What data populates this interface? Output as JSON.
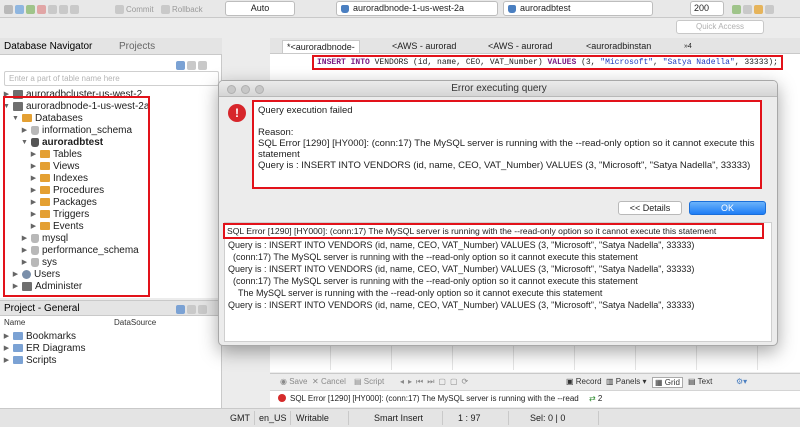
{
  "toolbar": {
    "commit_label": "Commit",
    "rollback_label": "Rollback",
    "transaction_mode": "Auto",
    "datasource": "auroradbnode-1-us-west-2a",
    "database": "auroradbtest",
    "result_limit": "200",
    "quick_access_placeholder": "Quick Access"
  },
  "nav": {
    "tab_active": "Database Navigator",
    "tab_inactive": "Projects",
    "filter_placeholder": "Enter a part of table name here",
    "items": [
      {
        "label": "auroradbcluster-us-west-2"
      },
      {
        "label": "auroradbnode-1-us-west-2a"
      },
      {
        "label": "Databases"
      },
      {
        "label": "information_schema"
      },
      {
        "label": "auroradbtest"
      },
      {
        "label": "Tables"
      },
      {
        "label": "Views"
      },
      {
        "label": "Indexes"
      },
      {
        "label": "Procedures"
      },
      {
        "label": "Packages"
      },
      {
        "label": "Triggers"
      },
      {
        "label": "Events"
      },
      {
        "label": "mysql"
      },
      {
        "label": "performance_schema"
      },
      {
        "label": "sys"
      },
      {
        "label": "Users"
      },
      {
        "label": "Administer"
      }
    ]
  },
  "project": {
    "tab": "Project - General",
    "col_name": "Name",
    "col_datasource": "DataSource",
    "items": [
      {
        "label": "Bookmarks"
      },
      {
        "label": "ER Diagrams"
      },
      {
        "label": "Scripts"
      }
    ]
  },
  "editor": {
    "tabs": [
      {
        "label": "*<auroradbnode-"
      },
      {
        "label": "<AWS - aurorad"
      },
      {
        "label": "<AWS - aurorad"
      },
      {
        "label": "<auroradbinstan"
      }
    ],
    "overflow_count": "»4",
    "sql": {
      "kw1": "INSERT INTO",
      "part1": " VENDORS (id, name, CEO, VAT_Number) ",
      "kw2": "VALUES",
      "part2": " (3, ",
      "str1": "\"Microsoft\"",
      "part3": ", ",
      "str2": "\"Satya Nadella\"",
      "part4": ", 33333);"
    }
  },
  "dialog": {
    "title": "Error executing query",
    "message_lines": [
      "Query execution failed",
      "",
      "Reason:",
      "SQL Error [1290] [HY000]: (conn:17) The MySQL server is running with the --read-only option so it cannot execute this statement",
      "Query is : INSERT INTO VENDORS (id, name, CEO, VAT_Number) VALUES (3, \"Microsoft\", \"Satya Nadella\", 33333)"
    ],
    "details_button": "<< Details",
    "ok_button": "OK",
    "details_highlight": "SQL Error [1290] [HY000]: (conn:17) The MySQL server is running with the --read-only option so it cannot execute this statement",
    "details_lines": [
      "Query is : INSERT INTO VENDORS (id, name, CEO, VAT_Number) VALUES (3, \"Microsoft\", \"Satya Nadella\", 33333)",
      "(conn:17) The MySQL server is running with the --read-only option so it cannot execute this statement",
      "Query is : INSERT INTO VENDORS (id, name, CEO, VAT_Number) VALUES (3, \"Microsoft\", \"Satya Nadella\", 33333)",
      "(conn:17) The MySQL server is running with the --read-only option so it cannot execute this statement",
      "The MySQL server is running with the --read-only option so it cannot execute this statement",
      "Query is : INSERT INTO VENDORS (id, name, CEO, VAT_Number) VALUES (3, \"Microsoft\", \"Satya Nadella\", 33333)"
    ]
  },
  "results_toolbar": {
    "save": "Save",
    "cancel": "Cancel",
    "script": "Script",
    "record": "Record",
    "panels": "Panels",
    "grid": "Grid",
    "text": "Text"
  },
  "message_bar": {
    "text": "SQL Error [1290] [HY000]: (conn:17) The MySQL server is running with the --read",
    "count": "2"
  },
  "status_bar": {
    "timezone": "GMT",
    "locale": "en_US",
    "mode": "Writable",
    "insert_mode": "Smart Insert",
    "position": "1 : 97",
    "selection": "Sel: 0 | 0"
  },
  "colors": {
    "highlight_red": "#e2121a",
    "ok_blue": "#1e7ef6",
    "error_red": "#d7262b"
  }
}
